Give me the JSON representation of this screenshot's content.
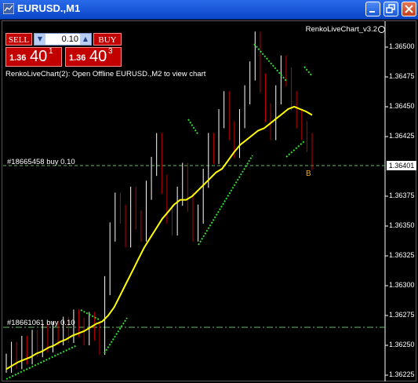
{
  "window": {
    "title": "EURUSD.,M1",
    "buttons": [
      "minimize-icon",
      "restore-icon",
      "close-icon"
    ]
  },
  "one_click": {
    "sell_label": "SELL",
    "buy_label": "BUY",
    "lot": "0.10",
    "sell_price": {
      "prefix": "1.36",
      "big": "40",
      "sup": "1"
    },
    "buy_price": {
      "prefix": "1.36",
      "big": "40",
      "sup": "3"
    }
  },
  "info_text": "RenkoLiveChart(2): Open Offline EURUSD.,M2 to view chart",
  "indicator_name": "RenkoLiveChart_v3.2",
  "orders": [
    {
      "label": "#18665458 buy 0.10",
      "price": 1.364
    },
    {
      "label": "#18661061 buy 0.10",
      "price": 1.3626
    }
  ],
  "current_price": "1.36401",
  "marker_letter": "B",
  "colors": {
    "bull": "#ffffff",
    "bear": "#c00000",
    "ma": "#ffff00",
    "trend": "#33dd33",
    "order_line": "#66bb66",
    "panel_red": "#c30000"
  },
  "chart_data": {
    "type": "line",
    "yaxis_ticks": [
      "1.36500",
      "1.36475",
      "1.36450",
      "1.36425",
      "1.36375",
      "1.36350",
      "1.36325",
      "1.36300",
      "1.36275",
      "1.36250",
      "1.36225"
    ],
    "ylim": [
      1.3622,
      1.36515
    ],
    "series": [
      {
        "values": [
          1.36235,
          1.36245,
          1.36238,
          1.3625,
          1.36242,
          1.36255,
          1.36248,
          1.3626,
          1.36252,
          1.36262,
          1.36258,
          1.36266,
          1.3626,
          1.36272,
          1.36265,
          1.36258,
          1.3627,
          1.36262,
          1.3625,
          1.363,
          1.36345,
          1.3637,
          1.3636,
          1.3634,
          1.36375,
          1.36355,
          1.36345,
          1.3638,
          1.364,
          1.3642,
          1.36385,
          1.3636,
          1.3635,
          1.36375,
          1.36395,
          1.3637,
          1.36345,
          1.3636,
          1.3639,
          1.3642,
          1.3641,
          1.3644,
          1.36455,
          1.3643,
          1.36415,
          1.3644,
          1.3646,
          1.3648,
          1.36505,
          1.3647,
          1.36445,
          1.3643,
          1.3646,
          1.36485,
          1.36475,
          1.36455,
          1.3644,
          1.3643,
          1.3642,
          1.36405
        ]
      },
      {
        "values": [
          1.3623,
          1.36233,
          1.36236,
          1.36238,
          1.3624,
          1.36243,
          1.36245,
          1.36248,
          1.3625,
          1.36253,
          1.36255,
          1.36258,
          1.3626,
          1.36262,
          1.36265,
          1.36268,
          1.3627,
          1.36275,
          1.36282,
          1.36292,
          1.36302,
          1.36312,
          1.36322,
          1.36332,
          1.3634,
          1.36348,
          1.36356,
          1.36362,
          1.36368,
          1.36372,
          1.36372,
          1.36375,
          1.3638,
          1.36385,
          1.3639,
          1.36395,
          1.36398,
          1.36405,
          1.36412,
          1.36418,
          1.36422,
          1.36426,
          1.3643,
          1.36432,
          1.36436,
          1.3644,
          1.36444,
          1.36448,
          1.3645,
          1.36448,
          1.36446,
          1.36443
        ]
      }
    ]
  }
}
